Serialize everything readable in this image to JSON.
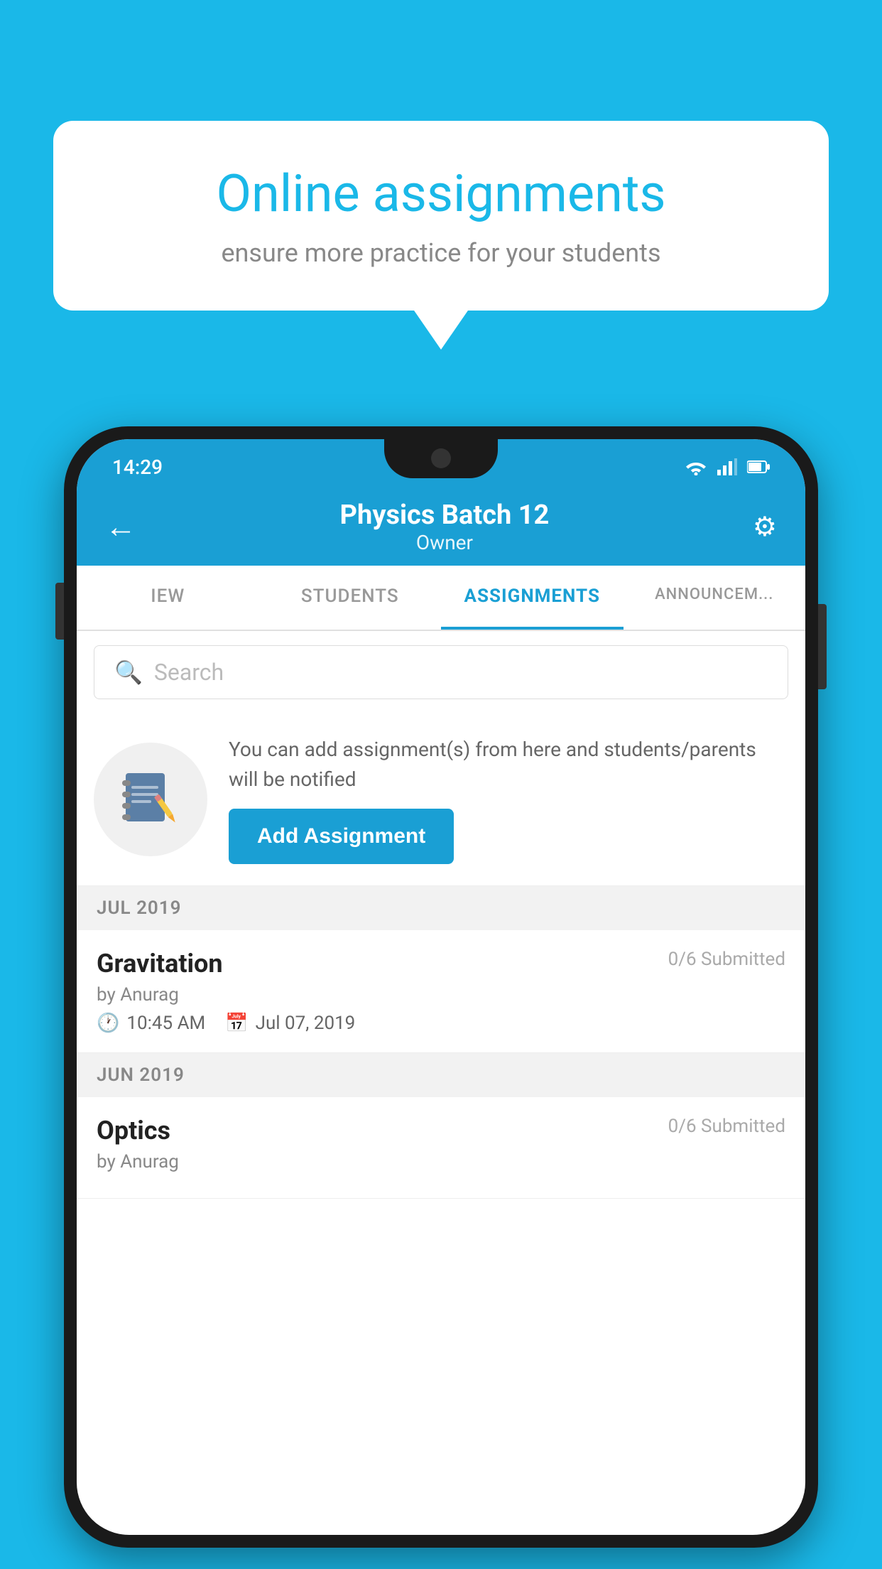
{
  "background_color": "#1ab8e8",
  "speech_bubble": {
    "title": "Online assignments",
    "subtitle": "ensure more practice for your students"
  },
  "phone": {
    "status_bar": {
      "time": "14:29",
      "icons": [
        "wifi",
        "signal",
        "battery"
      ]
    },
    "header": {
      "back_label": "←",
      "title": "Physics Batch 12",
      "subtitle": "Owner",
      "gear_label": "⚙"
    },
    "tabs": [
      {
        "label": "IEW",
        "active": false
      },
      {
        "label": "STUDENTS",
        "active": false
      },
      {
        "label": "ASSIGNMENTS",
        "active": true
      },
      {
        "label": "ANNOUNCEMENTS",
        "active": false
      }
    ],
    "search": {
      "placeholder": "Search"
    },
    "add_assignment_section": {
      "info_text": "You can add assignment(s) from here and students/parents will be notified",
      "button_label": "Add Assignment"
    },
    "assignments": [
      {
        "month": "JUL 2019",
        "items": [
          {
            "name": "Gravitation",
            "submitted": "0/6 Submitted",
            "by": "by Anurag",
            "time": "10:45 AM",
            "date": "Jul 07, 2019"
          }
        ]
      },
      {
        "month": "JUN 2019",
        "items": [
          {
            "name": "Optics",
            "submitted": "0/6 Submitted",
            "by": "by Anurag",
            "time": "",
            "date": ""
          }
        ]
      }
    ]
  }
}
